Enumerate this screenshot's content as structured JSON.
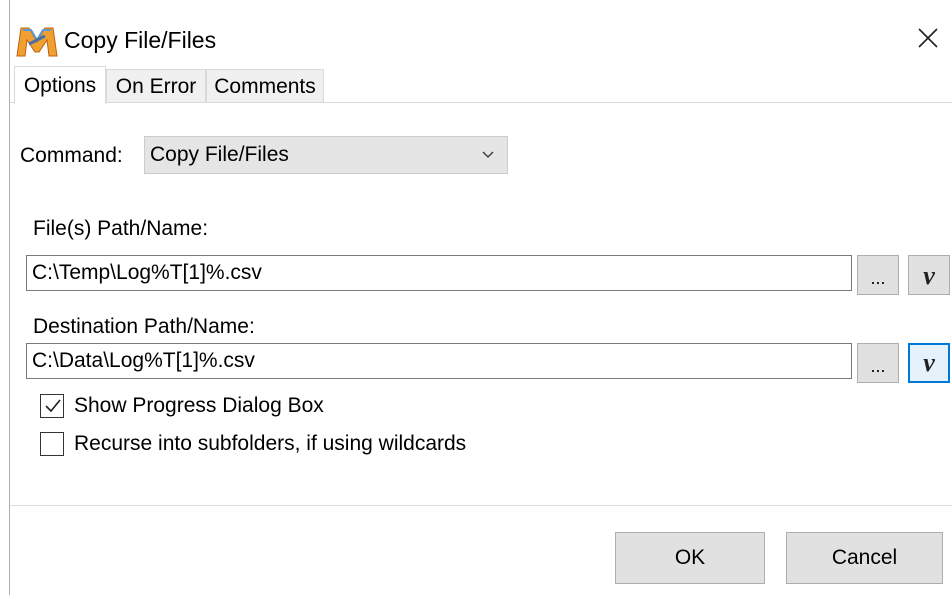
{
  "window": {
    "title": "Copy File/Files",
    "app_icon": "macro-m-icon",
    "close_symbol": "×"
  },
  "tabs": [
    {
      "label": "Options",
      "active": true
    },
    {
      "label": "On Error",
      "active": false
    },
    {
      "label": "Comments",
      "active": false
    }
  ],
  "command": {
    "label": "Command:",
    "selected": "Copy File/Files"
  },
  "source": {
    "label": "File(s) Path/Name:",
    "value": "C:\\Temp\\Log%T[1]%.csv",
    "browse_label": "...",
    "variable_label": "v"
  },
  "destination": {
    "label": "Destination Path/Name:",
    "value": "C:\\Data\\Log%T[1]%.csv",
    "browse_label": "...",
    "variable_label": "v"
  },
  "options": {
    "show_progress": {
      "label": "Show Progress Dialog Box",
      "checked": true
    },
    "recurse": {
      "label": "Recurse into subfolders, if using wildcards",
      "checked": false
    }
  },
  "buttons": {
    "ok": "OK",
    "cancel": "Cancel"
  },
  "colors": {
    "accent_focus": "#0078d7",
    "button_face": "#e1e1e1",
    "combo_face": "#e5e5e5"
  }
}
